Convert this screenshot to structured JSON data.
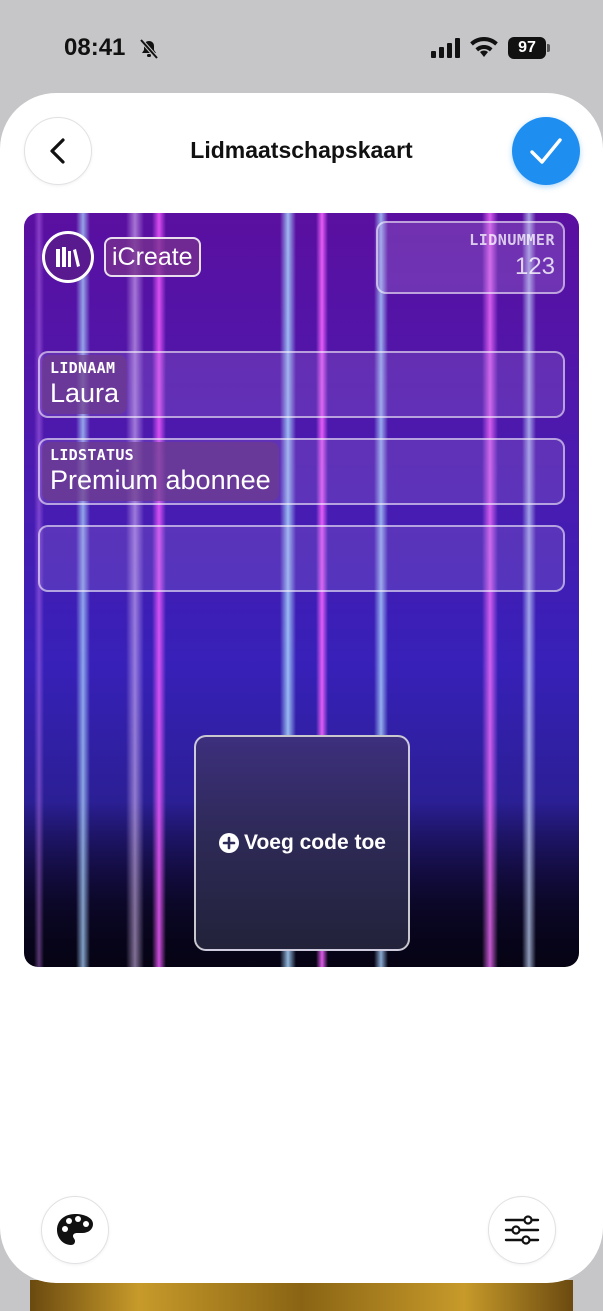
{
  "status_bar": {
    "time": "08:41",
    "battery": "97",
    "icons": [
      "bell-slash-icon",
      "cellular-signal-icon",
      "wifi-icon",
      "battery-icon"
    ]
  },
  "header": {
    "title": "Lidmaatschapskaart",
    "back_icon": "chevron-left-icon",
    "confirm_icon": "checkmark-icon"
  },
  "card": {
    "brand": "iCreate",
    "logo_icon": "books-icon",
    "member_number": {
      "label": "LIDNUMMER",
      "value": "123"
    },
    "fields": [
      {
        "label": "LIDNAAM",
        "value": "Laura"
      },
      {
        "label": "LIDSTATUS",
        "value": "Premium abonnee"
      },
      {
        "label": "",
        "value": ""
      }
    ],
    "code_button": {
      "label": "Voeg code toe",
      "icon": "plus-circle-icon"
    }
  },
  "toolbar": {
    "left_icon": "palette-icon",
    "right_icon": "sliders-icon"
  },
  "colors": {
    "accent": "#1f8ef1",
    "card_top": "#5a0fa0",
    "card_bottom": "#140c45"
  }
}
